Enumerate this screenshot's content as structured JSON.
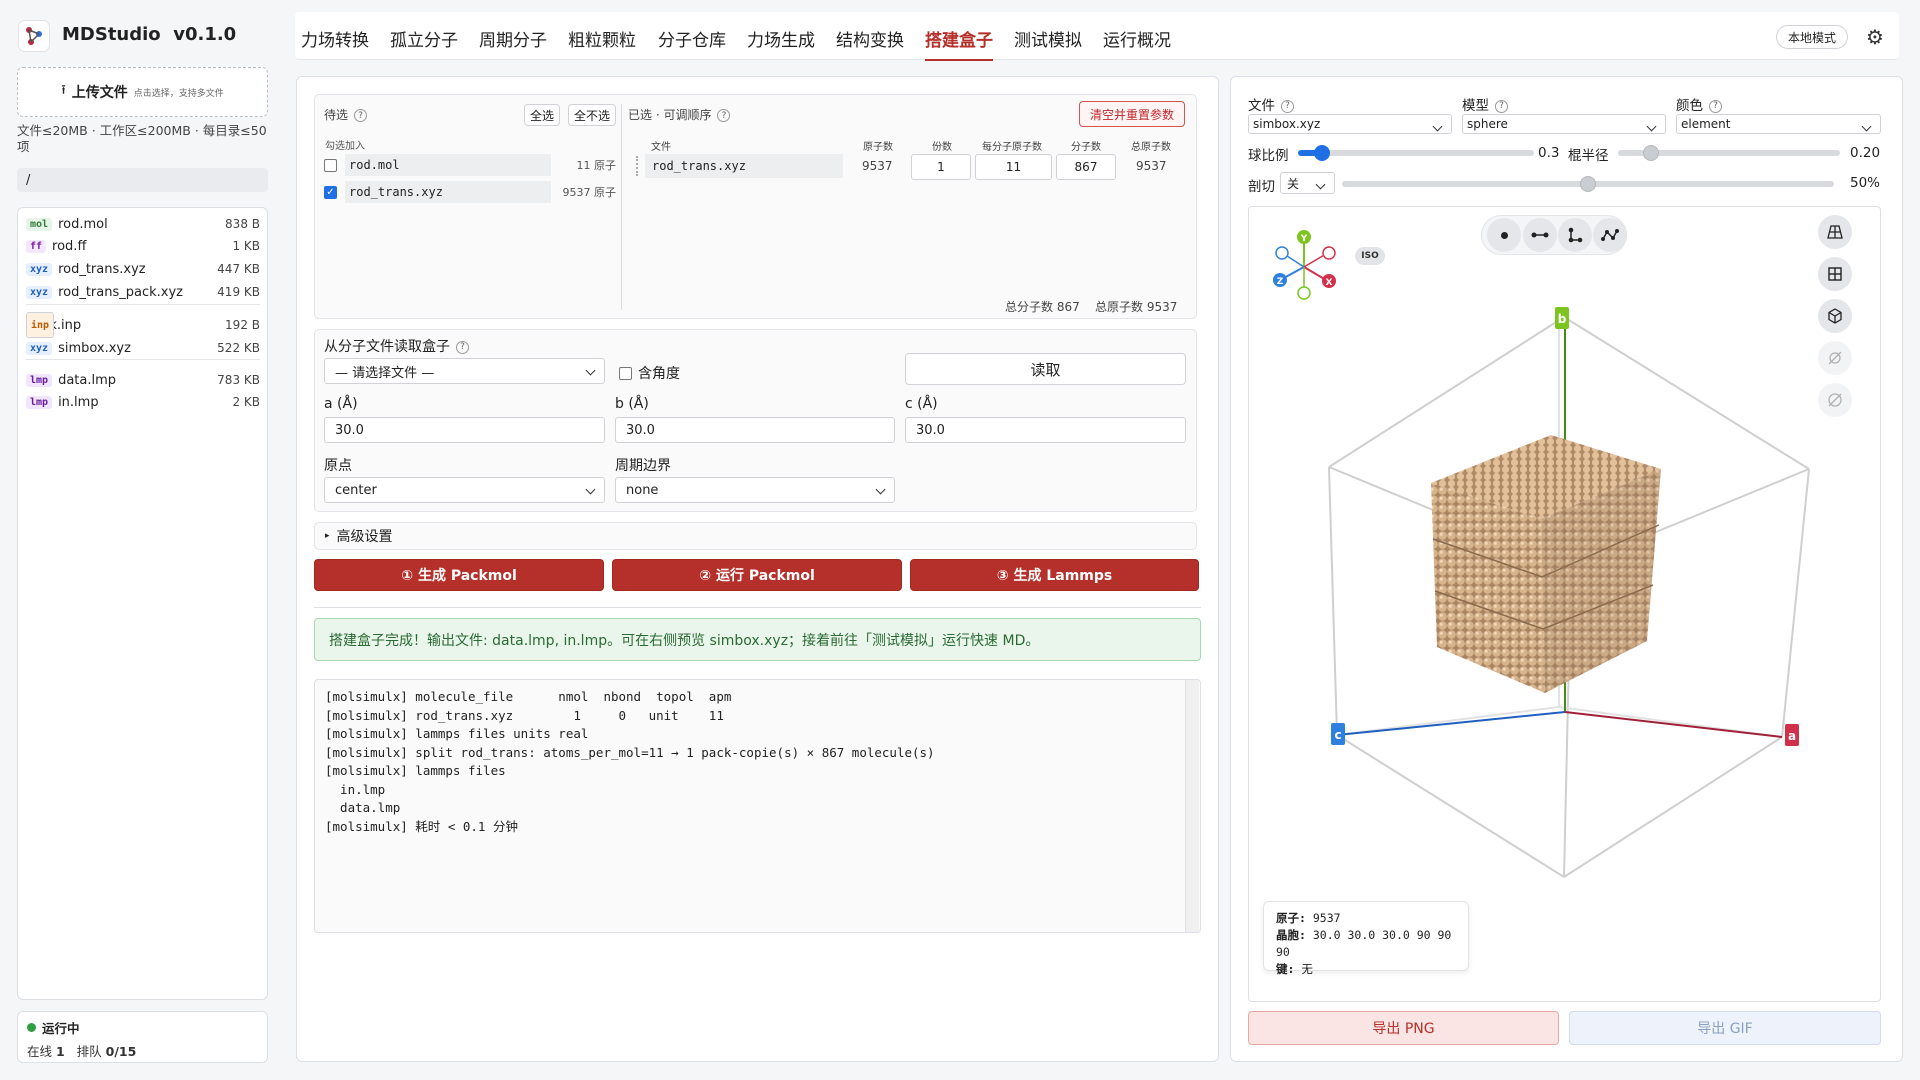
{
  "app": {
    "title": "MDStudio",
    "version": "v0.1.0"
  },
  "sidebar": {
    "upload_label": "上传文件",
    "upload_hint": "点击选择，支持多文件",
    "limits": "文件≤20MB · 工作区≤200MB · 每目录≤50",
    "limits2": "项",
    "path": "/",
    "files": [
      {
        "tag": "mol",
        "name": "rod.mol",
        "size": "838 B"
      },
      {
        "tag": "ff",
        "name": "rod.ff",
        "size": "1 KB"
      },
      {
        "tag": "xyz",
        "name": "rod_trans.xyz",
        "size": "447 KB"
      },
      {
        "tag": "xyz",
        "name": "rod_trans_pack.xyz",
        "size": "419 KB"
      },
      {
        "tag": "inp",
        "name": "pack.inp",
        "size": "192 B"
      },
      {
        "tag": "xyz",
        "name": "simbox.xyz",
        "size": "522 KB"
      },
      {
        "tag": "lmp",
        "name": "data.lmp",
        "size": "783 KB"
      },
      {
        "tag": "lmp",
        "name": "in.lmp",
        "size": "2 KB"
      }
    ],
    "status_label": "运行中",
    "status_detail_online_label": "在线",
    "status_online": "1",
    "status_queue_label": "排队",
    "status_queue": "0/15"
  },
  "tabs": [
    "力场转换",
    "孤立分子",
    "周期分子",
    "粗粒颗粒",
    "分子仓库",
    "力场生成",
    "结构变换",
    "搭建盒子",
    "测试模拟",
    "运行概况"
  ],
  "active_tab": "搭建盒子",
  "header_right": {
    "mode_label": "本地模式"
  },
  "pending": {
    "title": "待选",
    "select_all": "全选",
    "select_none": "全不选",
    "hint": "勾选加入",
    "items": [
      {
        "name": "rod.mol",
        "atoms": "11 原子",
        "checked": false
      },
      {
        "name": "rod_trans.xyz",
        "atoms": "9537 原子",
        "checked": true
      }
    ]
  },
  "selected": {
    "title": "已选 · 可调顺序",
    "clear_button": "清空并重置参数",
    "headers": {
      "file": "文件",
      "atoms": "原子数",
      "copies": "份数",
      "apm": "每分子原子数",
      "mols": "分子数",
      "total": "总原子数"
    },
    "rows": [
      {
        "file": "rod_trans.xyz",
        "atoms": "9537",
        "copies": "1",
        "apm": "11",
        "mols": "867",
        "total": "9537"
      }
    ],
    "summary_mols_label": "总分子数",
    "summary_mols": "867",
    "summary_atoms_label": "总原子数",
    "summary_atoms": "9537"
  },
  "box": {
    "title": "从分子文件读取盒子",
    "file_select": "— 请选择文件 —",
    "angle_label": "含角度",
    "read_button": "读取",
    "a_label": "a (Å)",
    "a_value": "30.0",
    "b_label": "b (Å)",
    "b_value": "30.0",
    "c_label": "c (Å)",
    "c_value": "30.0",
    "origin_label": "原点",
    "origin_value": "center",
    "pbc_label": "周期边界",
    "pbc_value": "none"
  },
  "advanced_label": "高级设置",
  "actions": {
    "gen_packmol": "① 生成 Packmol",
    "run_packmol": "② 运行 Packmol",
    "gen_lammps": "③ 生成 Lammps"
  },
  "success_message": "搭建盒子完成！输出文件: data.lmp, in.lmp。可在右侧预览 simbox.xyz；接着前往「测试模拟」运行快速 MD。",
  "log_lines": [
    "[molsimulx] molecule_file      nmol  nbond  topol  apm",
    "[molsimulx] rod_trans.xyz        1     0   unit    11",
    "[molsimulx] lammps files units real",
    "[molsimulx] split rod_trans: atoms_per_mol=11 → 1 pack-copie(s) × 867 molecule(s)",
    "[molsimulx] lammps files",
    "  in.lmp",
    "  data.lmp",
    "[molsimulx] 耗时 < 0.1 分钟"
  ],
  "viewer": {
    "file_label": "文件",
    "file_value": "simbox.xyz",
    "model_label": "模型",
    "model_value": "sphere",
    "color_label": "颜色",
    "color_value": "element",
    "ball_scale_label": "球比例",
    "ball_scale_value": "0.3",
    "ball_scale_fraction": 0.1,
    "rod_radius_label": "棍半径",
    "rod_radius_value": "0.20",
    "rod_radius_fraction": 0.15,
    "clip_label": "剖切",
    "clip_select": "关",
    "clip_value": "50%",
    "clip_fraction": 0.5,
    "iso_label": "ISO",
    "axis_labels": {
      "a": "a",
      "b": "b",
      "c": "c"
    },
    "gizmo": {
      "y": "Y",
      "z": "Z",
      "x": "X"
    },
    "info_atoms_label": "原子:",
    "info_atoms": "9537",
    "info_cell_label": "晶胞:",
    "info_cell": "30.0 30.0 30.0 90 90 90",
    "info_bonds_label": "键:",
    "info_bonds": "无",
    "export_png": "导出 PNG",
    "export_gif": "导出 GIF"
  },
  "colors": {
    "accent": "#b5302a",
    "atom": "#d8b48c",
    "axis_a": "#c0263a",
    "axis_b": "#7cc521",
    "axis_c": "#2f7fe0"
  }
}
